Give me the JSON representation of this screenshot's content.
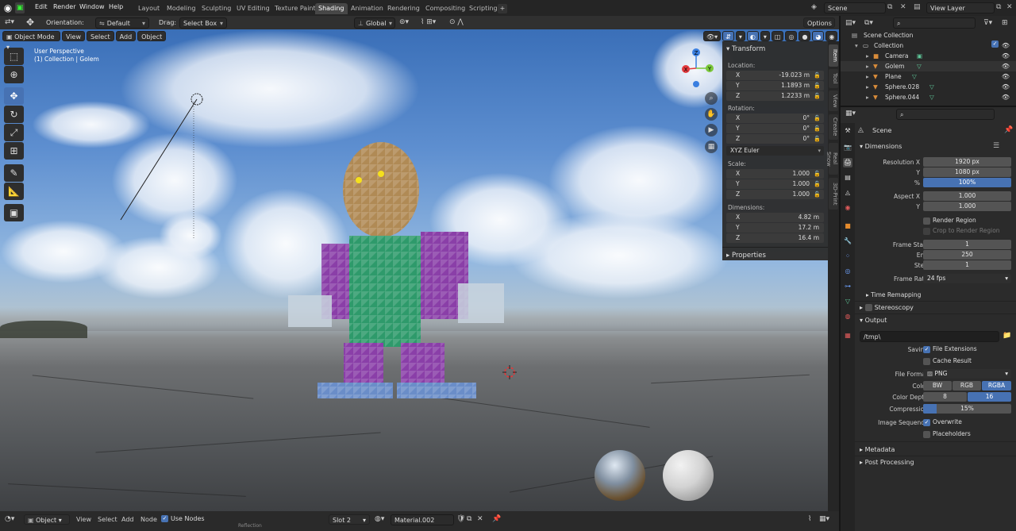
{
  "topbar": {
    "menus": [
      "Edit",
      "Render",
      "Window",
      "Help"
    ],
    "workspaces": [
      "Layout",
      "Modeling",
      "Sculpting",
      "UV Editing",
      "Texture Paint",
      "Shading",
      "Animation",
      "Rendering",
      "Compositing",
      "Scripting"
    ],
    "active_workspace": "Shading",
    "scene": "Scene",
    "view_layer": "View Layer"
  },
  "viewport_header": {
    "orientation_label": "Orientation:",
    "orientation_value": "Default",
    "drag_label": "Drag:",
    "drag_value": "Select Box",
    "transform_space": "Global",
    "options": "Options"
  },
  "viewport_header2": {
    "mode": "Object Mode",
    "menus": [
      "View",
      "Select",
      "Add",
      "Object"
    ]
  },
  "viewport": {
    "perspective": "User Perspective",
    "collection_info": "(1) Collection | Golem"
  },
  "npanel": {
    "transform_title": "Transform",
    "location_label": "Location:",
    "location": [
      {
        "k": "X",
        "v": "-19.023 m"
      },
      {
        "k": "Y",
        "v": "1.1893 m"
      },
      {
        "k": "Z",
        "v": "1.2233 m"
      }
    ],
    "rotation_label": "Rotation:",
    "rotation": [
      {
        "k": "X",
        "v": "0°"
      },
      {
        "k": "Y",
        "v": "0°"
      },
      {
        "k": "Z",
        "v": "0°"
      }
    ],
    "rotation_mode": "XYZ Euler",
    "scale_label": "Scale:",
    "scale": [
      {
        "k": "X",
        "v": "1.000"
      },
      {
        "k": "Y",
        "v": "1.000"
      },
      {
        "k": "Z",
        "v": "1.000"
      }
    ],
    "dimensions_label": "Dimensions:",
    "dimensions": [
      {
        "k": "X",
        "v": "4.82 m"
      },
      {
        "k": "Y",
        "v": "17.2 m"
      },
      {
        "k": "Z",
        "v": "16.4 m"
      }
    ],
    "properties_title": "Properties",
    "tabs": [
      "Item",
      "Tool",
      "View",
      "Create",
      "Real Snow",
      "3D-Print"
    ]
  },
  "bottombar": {
    "editor": "Object",
    "menus": [
      "View",
      "Select",
      "Add",
      "Node"
    ],
    "use_nodes": "Use Nodes",
    "slot": "Slot 2",
    "material": "Material.002",
    "partial": "Reflection"
  },
  "outliner": {
    "root": "Scene Collection",
    "collection": "Collection",
    "items": [
      {
        "name": "Camera",
        "icon_color": "#d98c3a"
      },
      {
        "name": "Golem",
        "icon_color": "#d98c3a"
      },
      {
        "name": "Plane",
        "icon_color": "#d98c3a"
      },
      {
        "name": "Sphere.028",
        "icon_color": "#d98c3a"
      },
      {
        "name": "Sphere.044",
        "icon_color": "#d98c3a"
      }
    ]
  },
  "properties": {
    "scene_name": "Scene",
    "dimensions_title": "Dimensions",
    "resolution_x_label": "Resolution X",
    "resolution_x": "1920 px",
    "resolution_y_label": "Y",
    "resolution_y": "1080 px",
    "percent_label": "%",
    "percent": "100%",
    "aspect_x_label": "Aspect X",
    "aspect_x": "1.000",
    "aspect_y_label": "Y",
    "aspect_y": "1.000",
    "render_region": "Render Region",
    "crop_region": "Crop to Render Region",
    "frame_start_label": "Frame Start",
    "frame_start": "1",
    "frame_end_label": "End",
    "frame_end": "250",
    "frame_step_label": "Step",
    "frame_step": "1",
    "frame_rate_label": "Frame Rate",
    "frame_rate": "24 fps",
    "time_remapping": "Time Remapping",
    "stereoscopy": "Stereoscopy",
    "output_title": "Output",
    "output_path": "/tmp\\",
    "saving_label": "Saving",
    "file_extensions": "File Extensions",
    "cache_result": "Cache Result",
    "file_format_label": "File Format",
    "file_format": "PNG",
    "color_label": "Color",
    "color_options": [
      "BW",
      "RGB",
      "RGBA"
    ],
    "color_active": "RGBA",
    "color_depth_label": "Color Depth",
    "color_depth_options": [
      "8",
      "16"
    ],
    "color_depth_active": "16",
    "compression_label": "Compression",
    "compression": "15%",
    "compression_fraction": 0.15,
    "image_sequence_label": "Image Sequence",
    "overwrite": "Overwrite",
    "placeholders": "Placeholders",
    "metadata": "Metadata",
    "post_processing": "Post Processing"
  },
  "colors": {
    "accent": "#4772b3",
    "panel": "#2b2b2b",
    "header": "#252525"
  }
}
